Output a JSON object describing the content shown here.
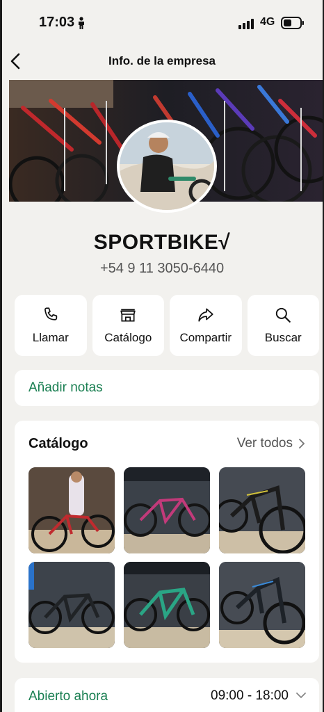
{
  "status_bar": {
    "time": "17:03",
    "network": "4G"
  },
  "nav": {
    "title": "Info. de la empresa"
  },
  "business": {
    "name": "SPORTBIKE√",
    "phone": "+54 9 11 3050-6440"
  },
  "actions": [
    {
      "label": "Llamar",
      "icon": "phone-icon"
    },
    {
      "label": "Catálogo",
      "icon": "store-icon"
    },
    {
      "label": "Compartir",
      "icon": "share-icon"
    },
    {
      "label": "Buscar",
      "icon": "search-icon"
    }
  ],
  "notes": {
    "label": "Añadir notas"
  },
  "catalog": {
    "title": "Catálogo",
    "see_all": "Ver todos"
  },
  "hours": {
    "status": "Abierto ahora",
    "range": "09:00 - 18:00"
  },
  "colors": {
    "accent": "#1a7f52",
    "background": "#f2f1ee",
    "card": "#ffffff"
  }
}
